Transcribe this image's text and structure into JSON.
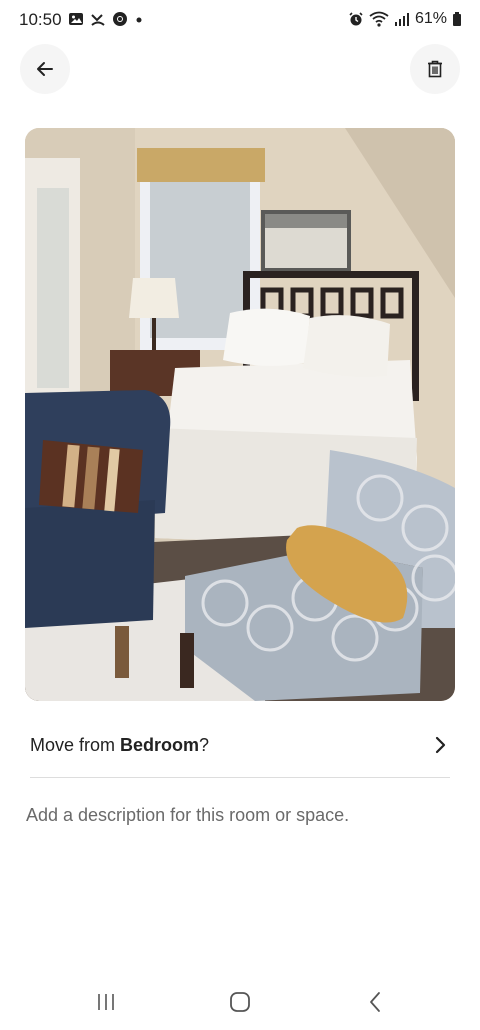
{
  "status_bar": {
    "time": "10:50",
    "battery": "61%",
    "icons": [
      "gallery-icon",
      "missed-call-icon",
      "chrome-icon",
      "dot-icon",
      "alarm-icon",
      "wifi-icon",
      "signal-icon",
      "battery-icon"
    ]
  },
  "header": {
    "back_icon": "arrow-left-icon",
    "delete_icon": "trash-icon"
  },
  "photo": {
    "subject": "bedroom-photo"
  },
  "move_row": {
    "prefix": "Move from ",
    "room": "Bedroom",
    "suffix": "?",
    "chevron_icon": "chevron-right-icon"
  },
  "description": {
    "placeholder": "Add a description for this room or space."
  },
  "nav_bar": {
    "items": [
      "recent-apps-icon",
      "home-icon",
      "back-nav-icon"
    ]
  },
  "colors": {
    "text": "#222222",
    "muted": "#6a6a6a",
    "divider": "#dddddd",
    "button_bg": "#f5f5f5"
  }
}
